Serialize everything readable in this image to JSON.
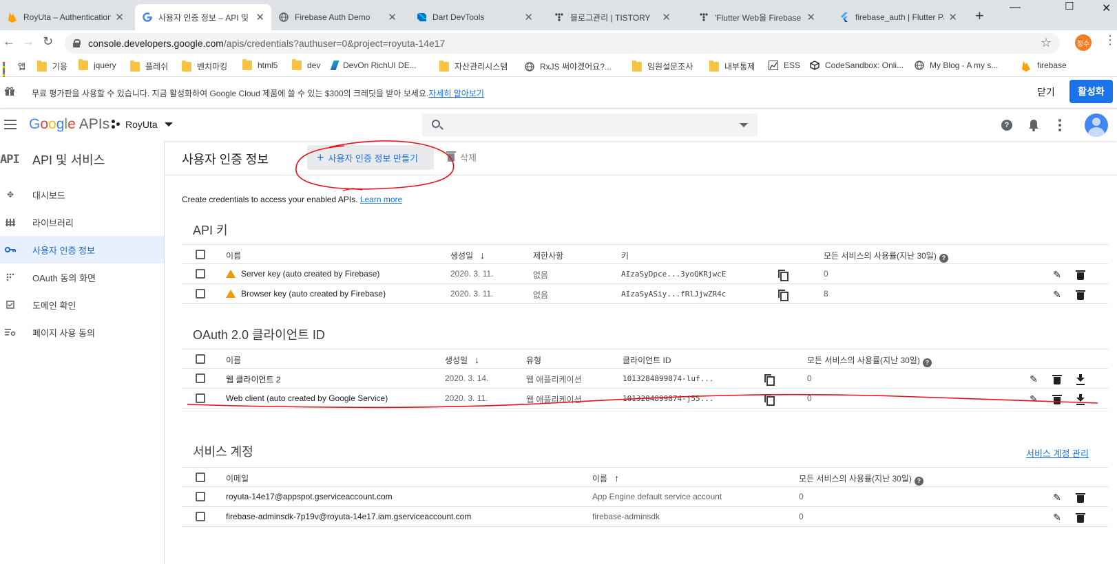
{
  "browser": {
    "tabs": [
      {
        "title": "RoyUta – Authentication",
        "favicon": "firebase-icon"
      },
      {
        "title": "사용자 인증 정보 – API 및",
        "favicon": "google-icon",
        "active": true
      },
      {
        "title": "Firebase Auth Demo",
        "favicon": "globe-icon"
      },
      {
        "title": "Dart DevTools",
        "favicon": "dart-icon"
      },
      {
        "title": "블로그관리 | TISTORY",
        "favicon": "tistory-icon"
      },
      {
        "title": "'Flutter Web을 Firebase A",
        "favicon": "tistory-icon"
      },
      {
        "title": "firebase_auth | Flutter Pa",
        "favicon": "flutter-icon"
      }
    ],
    "new_tab": "+",
    "url_host": "console.developers.google.com",
    "url_path": "/apis/credentials?authuser=0&project=royuta-14e17",
    "profile_initials": "정수",
    "bookmarks": [
      {
        "label": "앱",
        "icon": "apps-icon"
      },
      {
        "label": "기응",
        "icon": "folder-icon"
      },
      {
        "label": "jquery",
        "icon": "folder-icon"
      },
      {
        "label": "플레쉬",
        "icon": "folder-icon"
      },
      {
        "label": "벤치마킹",
        "icon": "folder-icon"
      },
      {
        "label": "html5",
        "icon": "folder-icon"
      },
      {
        "label": "dev",
        "icon": "folder-icon"
      },
      {
        "label": "DevOn RichUI DE...",
        "icon": "devon-icon"
      },
      {
        "label": "자산관리시스템",
        "icon": "folder-icon"
      },
      {
        "label": "RxJS 써야겠어요?...",
        "icon": "globe-icon"
      },
      {
        "label": "임원설문조사",
        "icon": "folder-icon"
      },
      {
        "label": "내부통제",
        "icon": "folder-icon"
      },
      {
        "label": "ESS",
        "icon": "ess-icon"
      },
      {
        "label": "CodeSandbox: Onli...",
        "icon": "codesandbox-icon"
      },
      {
        "label": "My Blog - A my s...",
        "icon": "globe-icon"
      },
      {
        "label": "firebase",
        "icon": "firebase-icon"
      }
    ]
  },
  "promo": {
    "message": "무료 평가판을 사용할 수 있습니다. 지금 활성화하여 Google Cloud 제품에 쓸 수 있는 $300의 크레딧을 받아 보세요.",
    "learn_more": "자세히 알아보기",
    "dismiss": "닫기",
    "activate": "활성화"
  },
  "header": {
    "logo_google": "Google",
    "logo_apis": "APIs",
    "project": "RoyUta"
  },
  "sidebar": {
    "mark": "API",
    "title": "API 및 서비스",
    "items": [
      {
        "label": "대시보드",
        "icon": "dashboard-icon"
      },
      {
        "label": "라이브러리",
        "icon": "library-icon"
      },
      {
        "label": "사용자 인증 정보",
        "icon": "key-icon",
        "active": true
      },
      {
        "label": "OAuth 동의 화면",
        "icon": "consent-icon"
      },
      {
        "label": "도메인 확인",
        "icon": "domain-icon"
      },
      {
        "label": "페이지 사용 동의",
        "icon": "page-usage-icon"
      }
    ]
  },
  "main": {
    "title": "사용자 인증 정보",
    "create_button": "사용자 인증 정보 만들기",
    "delete_button": "삭제",
    "intro": "Create credentials to access your enabled APIs.",
    "learn_more": "Learn more",
    "api_keys": {
      "title": "API 키",
      "headers": [
        "이름",
        "생성일",
        "제한사항",
        "키",
        "모든 서비스의 사용률(지난 30일)"
      ],
      "rows": [
        {
          "name": "Server key (auto created by Firebase)",
          "created": "2020. 3. 11.",
          "restriction": "없음",
          "key": "AIzaSyDpce...3yoQKRjwcE",
          "usage": "0"
        },
        {
          "name": "Browser key (auto created by Firebase)",
          "created": "2020. 3. 11.",
          "restriction": "없음",
          "key": "AIzaSyASiy...fRlJjwZR4c",
          "usage": "8"
        }
      ]
    },
    "oauth": {
      "title": "OAuth 2.0 클라이언트 ID",
      "headers": [
        "이름",
        "생성일",
        "유형",
        "클라이언트 ID",
        "모든 서비스의 사용률(지난 30일)"
      ],
      "rows": [
        {
          "name": "웹 클라이언트 2",
          "created": "2020. 3. 14.",
          "type": "웹 애플리케이션",
          "client_id": "1013284899874-luf...",
          "usage": "0"
        },
        {
          "name": "Web client (auto created by Google Service)",
          "created": "2020. 3. 11.",
          "type": "웹 애플리케이션",
          "client_id": "1013284899874-j55...",
          "usage": "0"
        }
      ]
    },
    "service_accounts": {
      "title": "서비스 계정",
      "manage_link": "서비스 계정 관리",
      "headers": [
        "이메일",
        "이름",
        "모든 서비스의 사용률(지난 30일)"
      ],
      "rows": [
        {
          "email": "royuta-14e17@appspot.gserviceaccount.com",
          "name": "App Engine default service account",
          "usage": "0"
        },
        {
          "email": "firebase-adminsdk-7p19v@royuta-14e17.iam.gserviceaccount.com",
          "name": "firebase-adminsdk",
          "usage": "0"
        }
      ]
    }
  },
  "colors": {
    "accent": "#1a73e8",
    "sidebar_active_bg": "#e8f0fe",
    "warning": "#f29900",
    "annotation": "#e8101a"
  }
}
